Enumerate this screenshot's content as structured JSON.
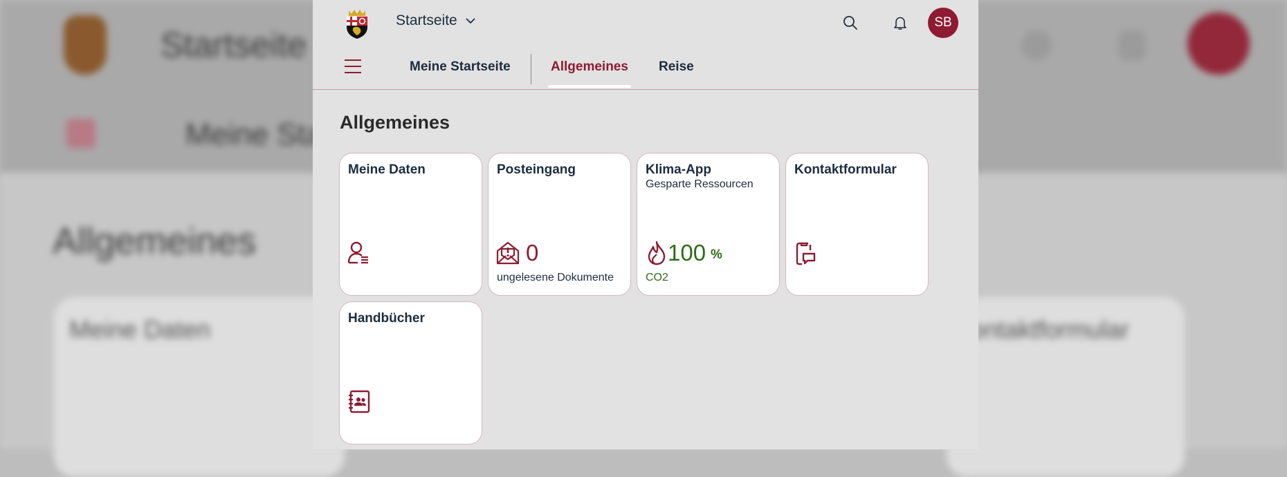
{
  "background": {
    "title": "Startseite",
    "tab": "Meine Star",
    "heading": "Allgemeines",
    "card_left": "Meine Daten",
    "card_right": "ontaktformular"
  },
  "shell": {
    "title": "Startseite",
    "avatar_initials": "SB",
    "icons": [
      "coat-of-arms-logo",
      "search-icon",
      "bell-icon"
    ]
  },
  "nav": {
    "tabs": [
      {
        "label": "Meine Startseite",
        "active": false
      },
      {
        "label": "Allgemeines",
        "active": true
      },
      {
        "label": "Reise",
        "active": false
      }
    ]
  },
  "section": {
    "title": "Allgemeines"
  },
  "tiles": [
    {
      "title": "Meine Daten",
      "icon": "user-list-icon"
    },
    {
      "title": "Posteingang",
      "icon": "inbox-alert-icon",
      "kpi": "0",
      "footer": "ungelesene Dokumente"
    },
    {
      "title": "Klima-App",
      "subtitle": "Gesparte Ressourcen",
      "icon": "flame-icon",
      "kpi": "100",
      "kpi_unit": "%",
      "footer": "CO2"
    },
    {
      "title": "Kontaktformular",
      "icon": "phone-message-icon"
    },
    {
      "title": "Handbücher",
      "icon": "address-book-icon"
    }
  ],
  "colors": {
    "brand": "#8e1b32",
    "positive": "#2f6b1a",
    "neutral_text": "#1d2d3e"
  }
}
